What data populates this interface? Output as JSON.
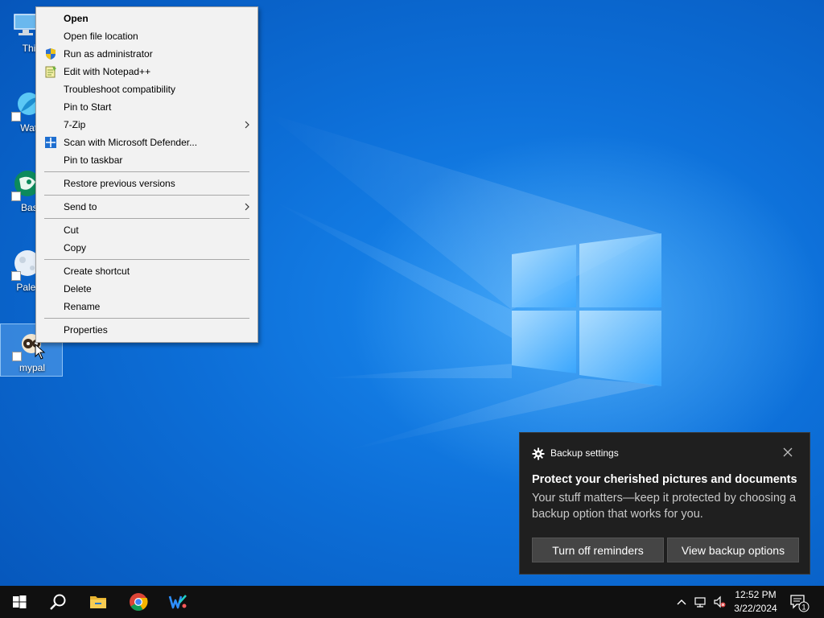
{
  "desktop": {
    "icons": [
      {
        "label": "This",
        "name": "this-pc"
      },
      {
        "label": "Wate",
        "name": "waterfox"
      },
      {
        "label": "Basil",
        "name": "basilisk"
      },
      {
        "label": "Pale M",
        "name": "pale-moon"
      },
      {
        "label": "mypal",
        "name": "mypal"
      }
    ]
  },
  "context_menu": {
    "items": [
      {
        "label": "Open",
        "bold": true
      },
      {
        "label": "Open file location"
      },
      {
        "label": "Run as administrator",
        "icon": "uac-shield-icon"
      },
      {
        "label": "Edit with Notepad++",
        "icon": "notepadpp-icon"
      },
      {
        "label": "Troubleshoot compatibility"
      },
      {
        "label": "Pin to Start"
      },
      {
        "label": "7-Zip",
        "submenu": true
      },
      {
        "label": "Scan with Microsoft Defender...",
        "icon": "defender-icon"
      },
      {
        "label": "Pin to taskbar"
      },
      {
        "label": "Restore previous versions"
      },
      {
        "label": "Send to",
        "submenu": true
      },
      {
        "label": "Cut"
      },
      {
        "label": "Copy"
      },
      {
        "label": "Create shortcut"
      },
      {
        "label": "Delete"
      },
      {
        "label": "Rename"
      },
      {
        "label": "Properties"
      }
    ]
  },
  "toast": {
    "app": "Backup settings",
    "title": "Protect your cherished pictures and documents",
    "body": "Your stuff matters—keep it protected by choosing a backup option that works for you.",
    "button_dismiss": "Turn off reminders",
    "button_action": "View backup options"
  },
  "taskbar": {
    "pinned": [
      "start-icon",
      "search-icon",
      "file-explorer-icon",
      "chrome-icon",
      "wps-icon"
    ],
    "tray": [
      "chevron-up-icon",
      "network-icon",
      "volume-muted-icon"
    ],
    "time": "12:52 PM",
    "date": "3/22/2024",
    "notification_count": "1"
  },
  "colors": {
    "taskbar": "#101010",
    "menu_bg": "#f2f2f2",
    "toast_bg": "#1f1f1f",
    "toast_button": "#454545"
  }
}
